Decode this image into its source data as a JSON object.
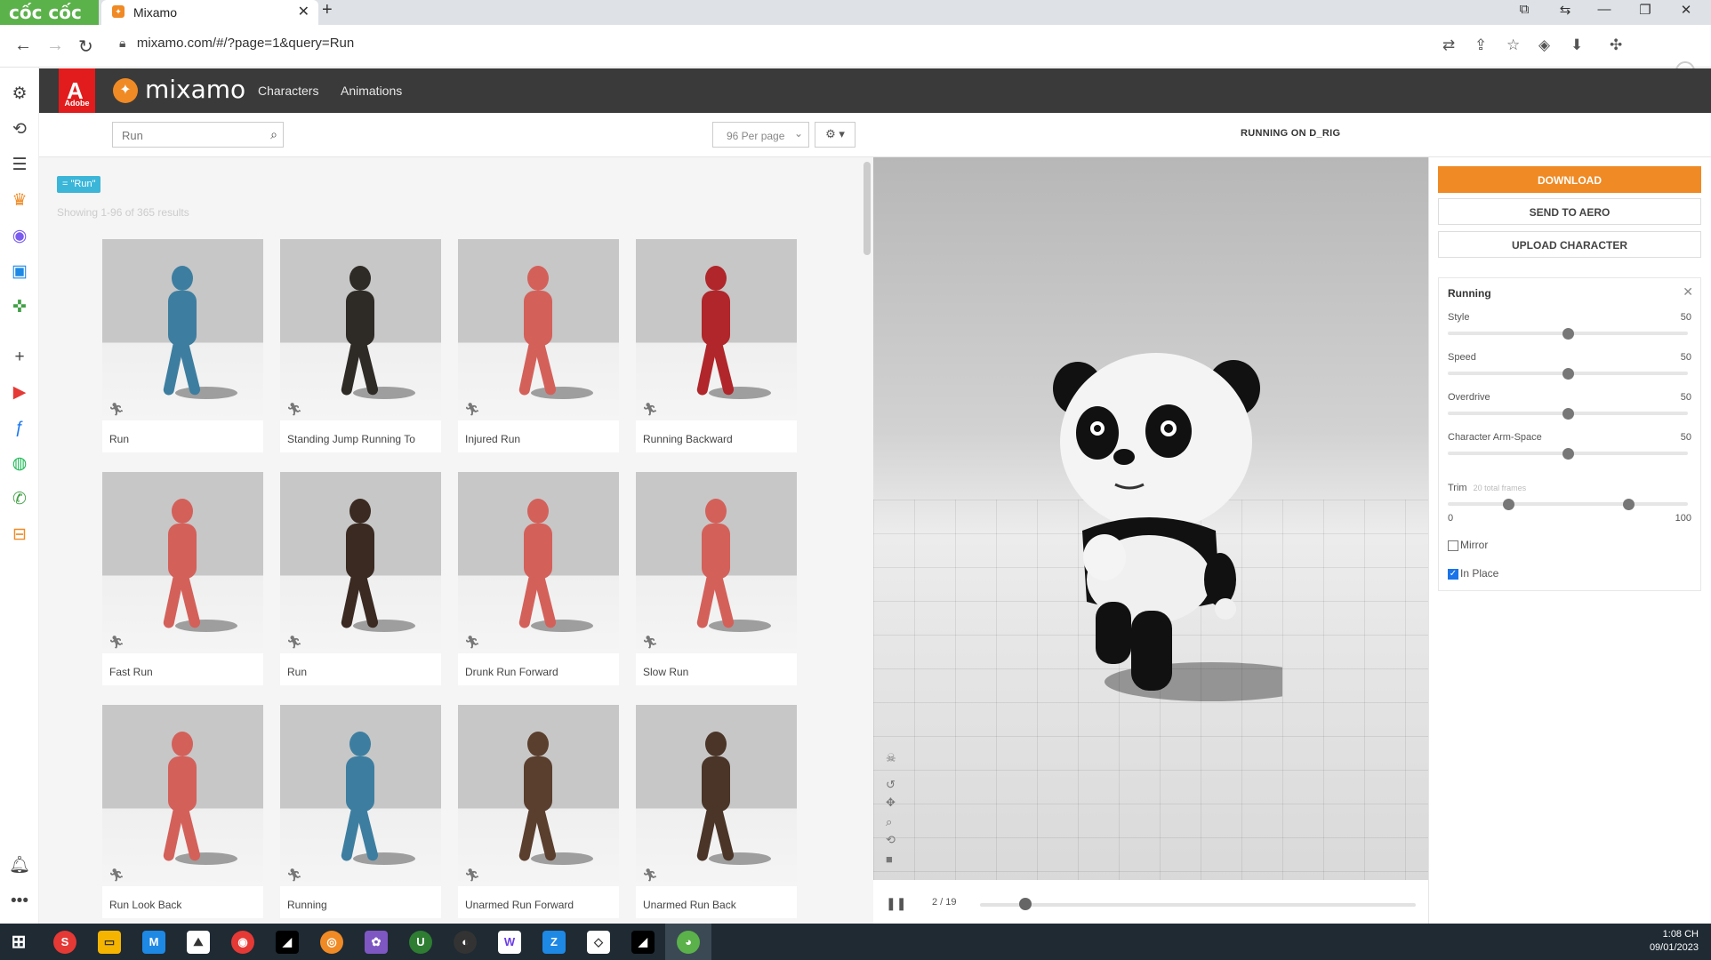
{
  "browser": {
    "name": "cốc cốc",
    "tab_title": "Mixamo",
    "url": "mixamo.com/#/?page=1&query=Run"
  },
  "mixamo": {
    "brand": "mixamo",
    "adobe_label": "Adobe",
    "nav": [
      "Characters",
      "Animations"
    ]
  },
  "search": {
    "value": "Run",
    "per_page": "96 Per page",
    "tag": "= \"Run\"",
    "showing": "Showing 1-96 of 365 results"
  },
  "cards": [
    {
      "label": "Run",
      "color": "#3d7ea0"
    },
    {
      "label": "Standing Jump Running To",
      "color": "#2e2a25"
    },
    {
      "label": "Injured Run",
      "color": "#d4605a"
    },
    {
      "label": "Running Backward",
      "color": "#b0262a"
    },
    {
      "label": "Fast Run",
      "color": "#d4605a"
    },
    {
      "label": "Run",
      "color": "#3a2a22"
    },
    {
      "label": "Drunk Run Forward",
      "color": "#d4605a"
    },
    {
      "label": "Slow Run",
      "color": "#d4605a"
    },
    {
      "label": "Run Look Back",
      "color": "#d4605a"
    },
    {
      "label": "Running",
      "color": "#3d7ea0"
    },
    {
      "label": "Unarmed Run Forward",
      "color": "#5a3e2e"
    },
    {
      "label": "Unarmed Run Back",
      "color": "#4a3528"
    }
  ],
  "viewer": {
    "title": "RUNNING ON D_RIG",
    "frame": "2 / 19",
    "frame_progress": 0.105
  },
  "actions": {
    "download": "DOWNLOAD",
    "send": "SEND TO AERO",
    "upload": "UPLOAD CHARACTER"
  },
  "settings": {
    "title": "Running",
    "sliders": [
      {
        "label": "Style",
        "value": "50"
      },
      {
        "label": "Speed",
        "value": "50"
      },
      {
        "label": "Overdrive",
        "value": "50"
      },
      {
        "label": "Character Arm-Space",
        "value": "50"
      }
    ],
    "trim": {
      "label": "Trim",
      "sub": "20 total frames",
      "min": "0",
      "max": "100",
      "start": 25,
      "end": 75
    },
    "mirror": "Mirror",
    "in_place": "In Place",
    "mirror_checked": false,
    "in_place_checked": true
  },
  "taskbar": {
    "time": "1:08 CH",
    "date": "09/01/2023"
  },
  "colors": {
    "accent": "#f08a24",
    "tag": "#3bb6d9",
    "adobe": "#e21c1c"
  }
}
